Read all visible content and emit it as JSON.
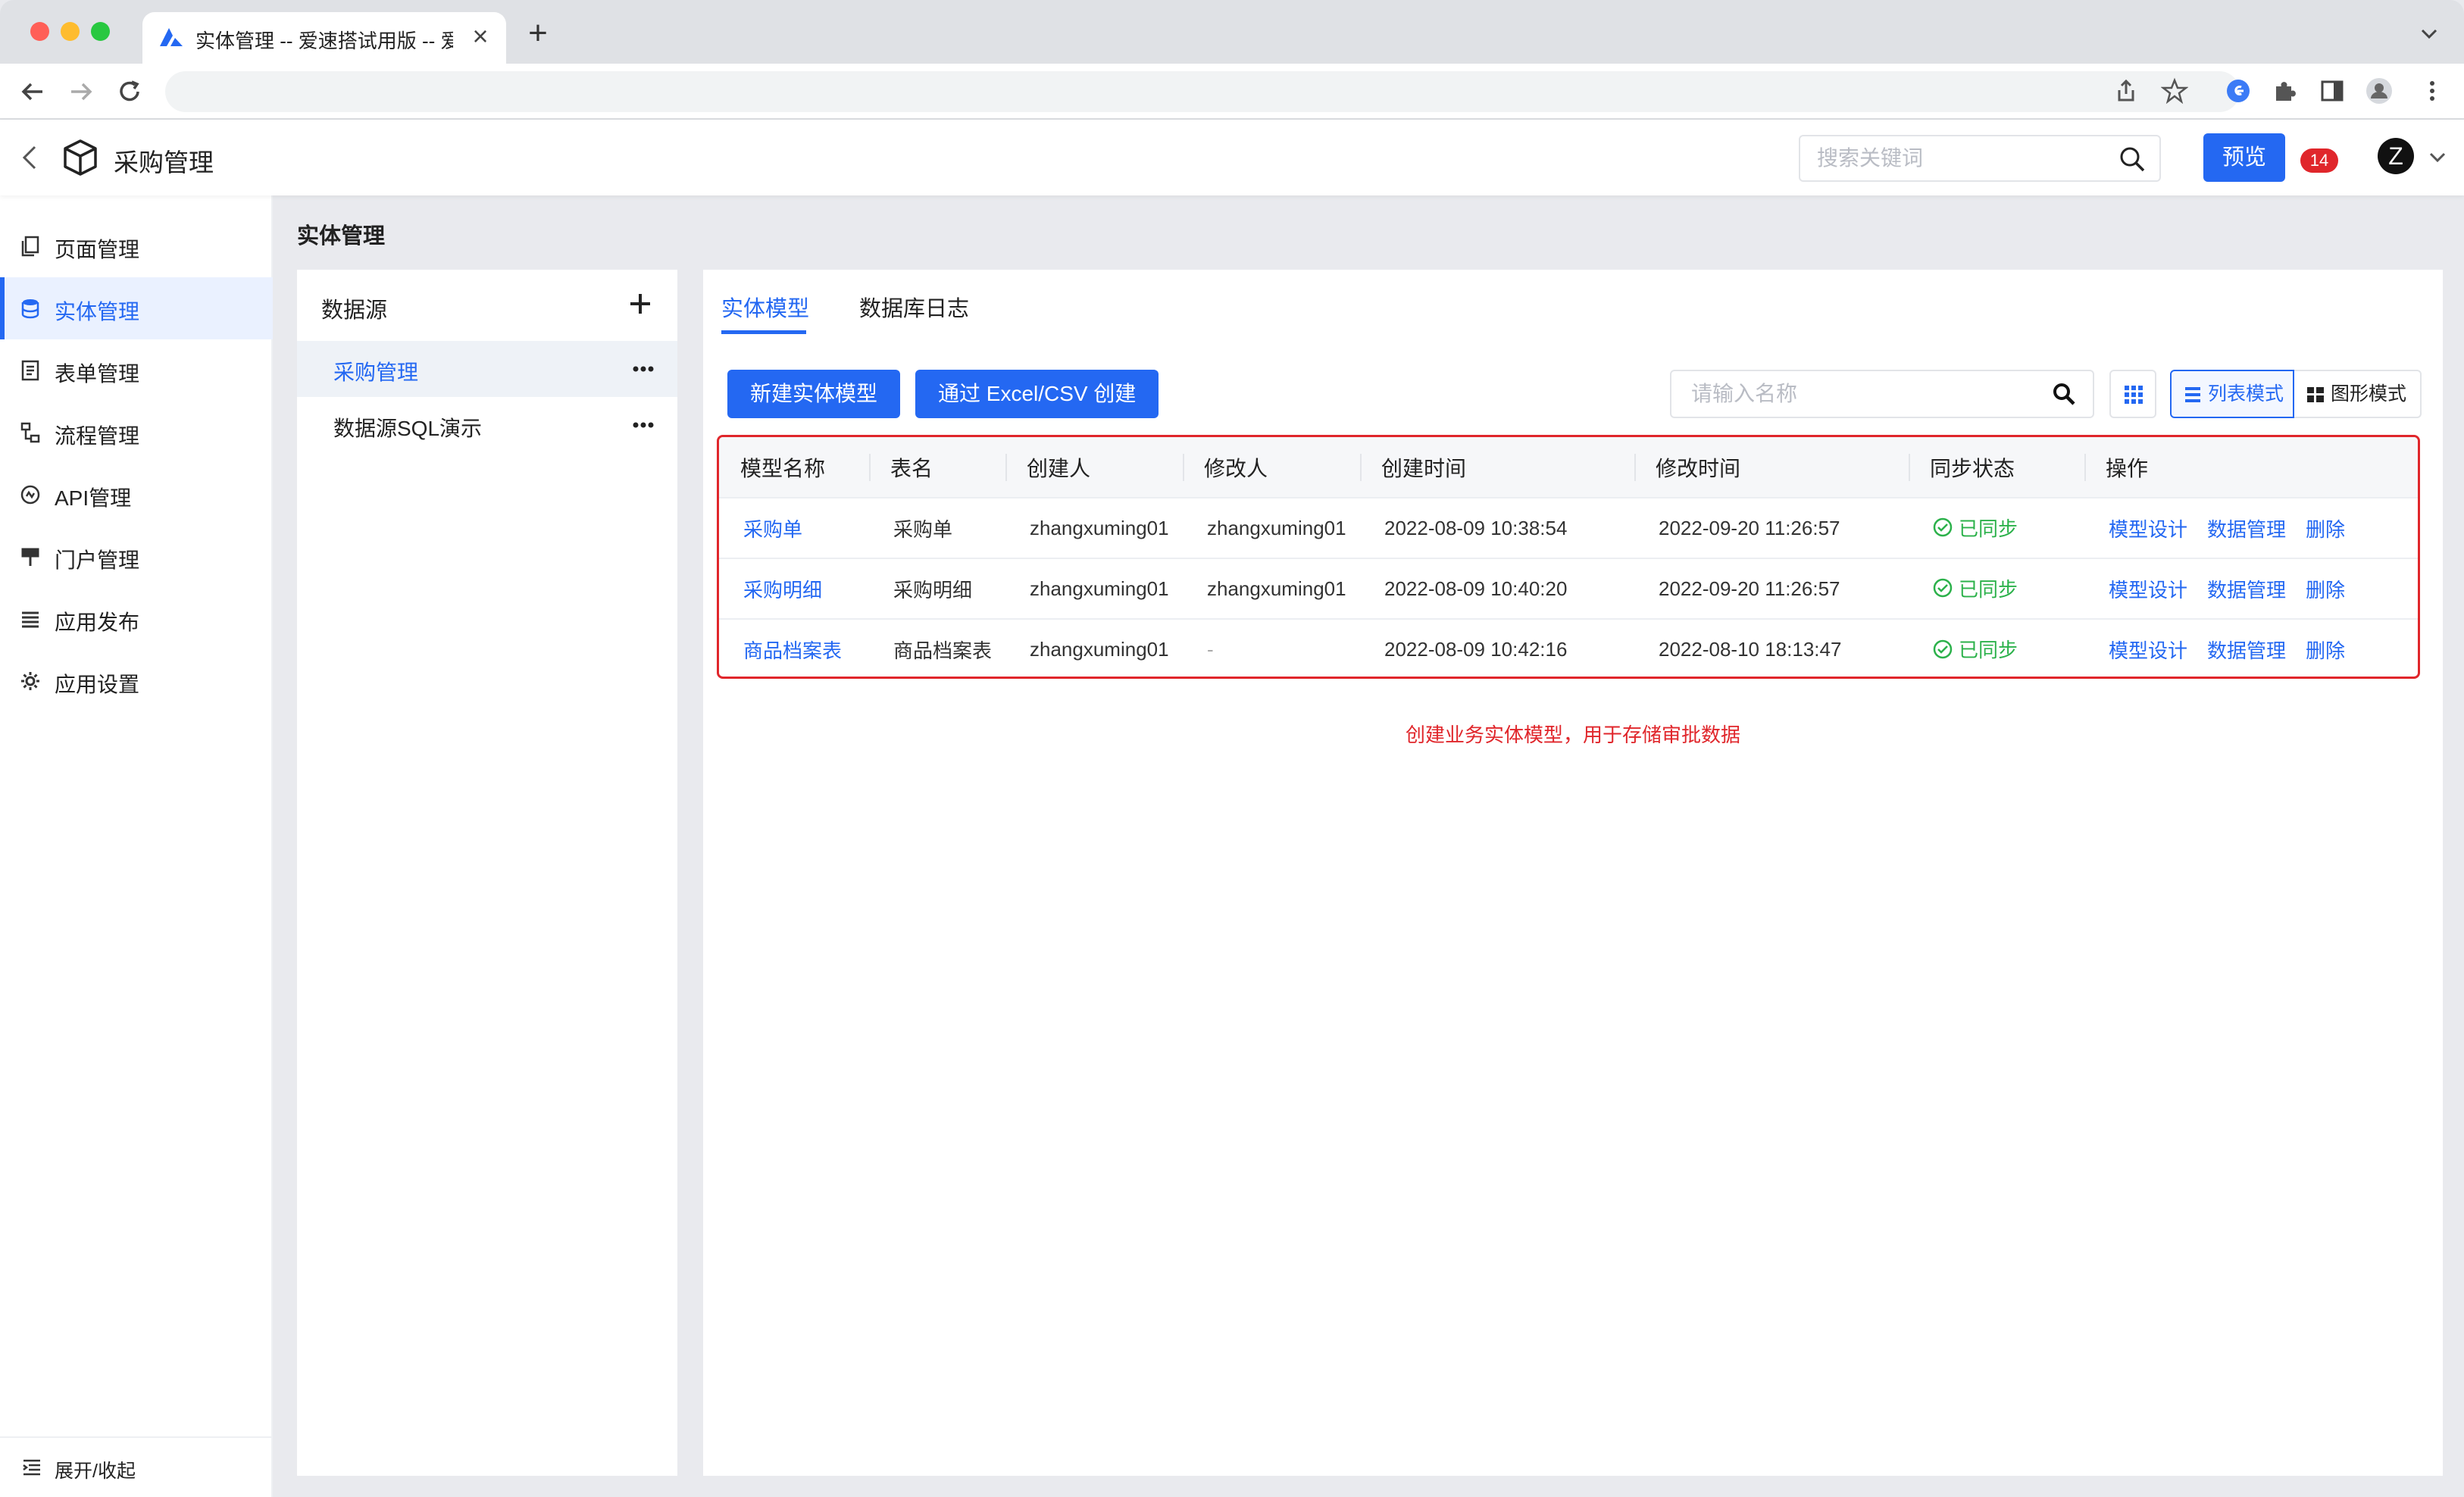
{
  "browser": {
    "tab_title": "实体管理 -- 爱速搭试用版 -- 爱速搭",
    "tab_close": "×",
    "new_tab": "+"
  },
  "header": {
    "app_title": "采购管理",
    "search_placeholder": "搜索关键词",
    "preview_label": "预览",
    "notification_count": "14",
    "avatar_letter": "Z"
  },
  "sidenav": {
    "items": [
      {
        "label": "页面管理",
        "icon": "pages-icon"
      },
      {
        "label": "实体管理",
        "icon": "database-icon",
        "active": true
      },
      {
        "label": "表单管理",
        "icon": "form-icon"
      },
      {
        "label": "流程管理",
        "icon": "flow-icon"
      },
      {
        "label": "API管理",
        "icon": "api-icon"
      },
      {
        "label": "门户管理",
        "icon": "portal-icon"
      },
      {
        "label": "应用发布",
        "icon": "publish-icon"
      },
      {
        "label": "应用设置",
        "icon": "gear-icon"
      }
    ],
    "collapse_label": "展开/收起"
  },
  "breadcrumb": "实体管理",
  "datasource": {
    "title": "数据源",
    "items": [
      {
        "label": "采购管理",
        "active": true
      },
      {
        "label": "数据源SQL演示"
      }
    ]
  },
  "main": {
    "tabs": [
      {
        "label": "实体模型",
        "active": true
      },
      {
        "label": "数据库日志"
      }
    ],
    "create_button": "新建实体模型",
    "import_button": "通过 Excel/CSV 创建",
    "name_search_placeholder": "请输入名称",
    "mode_list": "列表模式",
    "mode_graph": "图形模式",
    "table": {
      "columns": [
        "模型名称",
        "表名",
        "创建人",
        "修改人",
        "创建时间",
        "修改时间",
        "同步状态",
        "操作"
      ],
      "rows": [
        {
          "model": "采购单",
          "table": "采购单",
          "creator": "zhangxuming01",
          "modifier": "zhangxuming01",
          "created": "2022-08-09 10:38:54",
          "modified": "2022-09-20 11:26:57",
          "status": "已同步"
        },
        {
          "model": "采购明细",
          "table": "采购明细",
          "creator": "zhangxuming01",
          "modifier": "zhangxuming01",
          "created": "2022-08-09 10:40:20",
          "modified": "2022-09-20 11:26:57",
          "status": "已同步"
        },
        {
          "model": "商品档案表",
          "table": "商品档案表",
          "creator": "zhangxuming01",
          "modifier": "-",
          "created": "2022-08-09 10:42:16",
          "modified": "2022-08-10 18:13:47",
          "status": "已同步"
        }
      ],
      "actions": [
        "模型设计",
        "数据管理",
        "删除"
      ]
    },
    "annotation": "创建业务实体模型，用于存储审批数据"
  },
  "colors": {
    "accent": "#2468f2",
    "danger": "#e0262b",
    "success": "#2bb14a"
  }
}
